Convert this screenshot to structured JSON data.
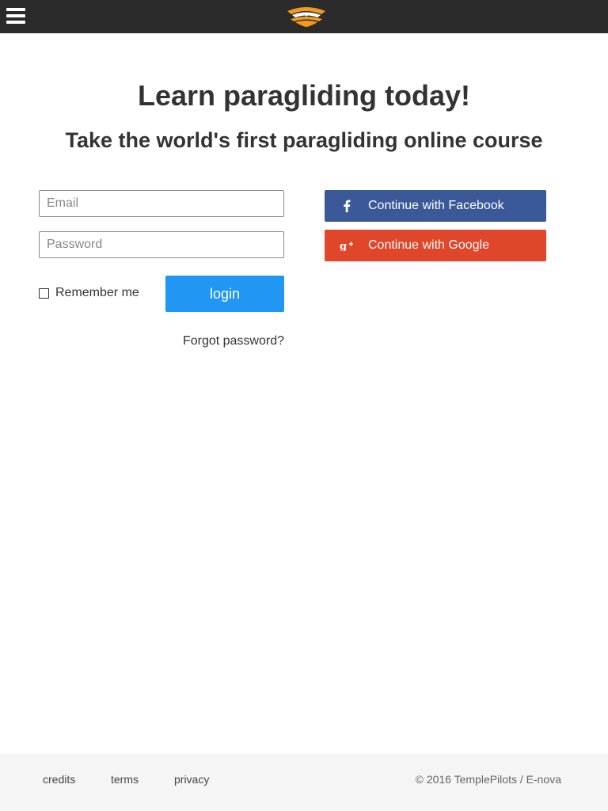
{
  "header": {
    "menu_icon": "hamburger-menu-icon",
    "logo_icon": "paraglider-wing-logo"
  },
  "hero": {
    "title": "Learn paragliding today!",
    "subtitle": "Take the world's first paragliding online course"
  },
  "login_form": {
    "email_placeholder": "Email",
    "email_value": "",
    "password_placeholder": "Password",
    "password_value": "",
    "remember_label": "Remember me",
    "remember_checked": false,
    "login_label": "login",
    "forgot_label": "Forgot password?"
  },
  "social": {
    "facebook_label": "Continue with Facebook",
    "facebook_icon": "facebook-icon",
    "google_label": "Continue with Google",
    "google_icon": "google-plus-icon"
  },
  "footer": {
    "links": [
      "credits",
      "terms",
      "privacy"
    ],
    "copyright": "© 2016 TemplePilots / E-nova"
  },
  "colors": {
    "topbar": "#2b2b2b",
    "login_button": "#2196f3",
    "facebook": "#3b5998",
    "google": "#e0472a",
    "logo_orange": "#f39a1e"
  }
}
